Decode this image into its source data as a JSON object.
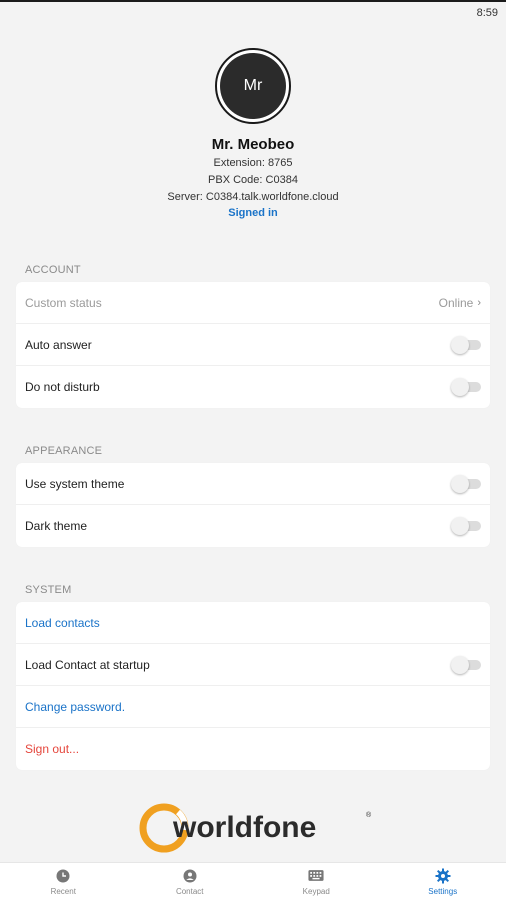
{
  "status_bar": {
    "time": "8:59"
  },
  "profile": {
    "initials": "Mr",
    "name": "Mr. Meobeo",
    "extension": "Extension: 8765",
    "pbx_code": "PBX Code: C0384",
    "server": "Server: C0384.talk.worldfone.cloud",
    "status": "Signed in"
  },
  "account": {
    "title": "ACCOUNT",
    "custom_status_label": "Custom status",
    "custom_status_value": "Online",
    "auto_answer_label": "Auto answer",
    "do_not_disturb_label": "Do not disturb"
  },
  "appearance": {
    "title": "APPEARANCE",
    "use_system_theme_label": "Use system theme",
    "dark_theme_label": "Dark theme"
  },
  "system": {
    "title": "SYSTEM",
    "load_contacts_label": "Load contacts",
    "load_contact_startup_label": "Load Contact at startup",
    "change_password_label": "Change password.",
    "sign_out_label": "Sign out..."
  },
  "toggles": {
    "auto_answer": false,
    "do_not_disturb": false,
    "use_system_theme": false,
    "dark_theme": false,
    "load_contact_startup": false
  },
  "logo": {
    "text": "worldfone"
  },
  "bottom_nav": {
    "items": [
      {
        "label": "Recent",
        "icon": "clock-icon"
      },
      {
        "label": "Contact",
        "icon": "person-icon"
      },
      {
        "label": "Keypad",
        "icon": "keyboard-icon"
      },
      {
        "label": "Settings",
        "icon": "gear-icon"
      }
    ],
    "active": "Settings"
  },
  "colors": {
    "accent": "#1a73c8",
    "danger": "#e5463c",
    "logo_text": "#2b2b2b",
    "logo_ring": "#f0a020"
  }
}
